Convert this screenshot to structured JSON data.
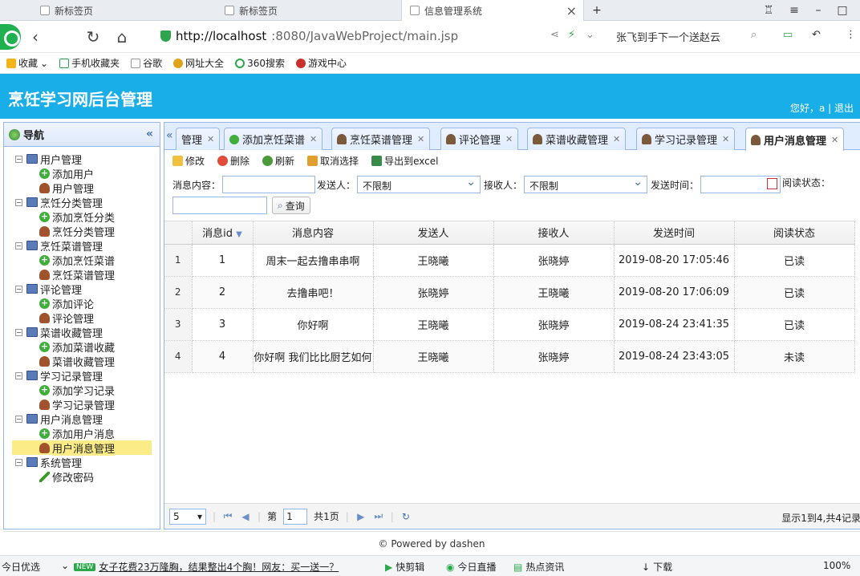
{
  "browser": {
    "tabs": [
      "新标签页",
      "新标签页",
      "信息管理系统"
    ],
    "url_host": "http://localhost",
    "url_rest": ":8080/JavaWebProject/main.jsp",
    "news_ticker": "张飞到手下一个送赵云",
    "bookmarks": [
      "收藏",
      "手机收藏夹",
      "谷歌",
      "网址大全",
      "360搜索",
      "游戏中心"
    ]
  },
  "app": {
    "title": "烹饪学习网后台管理",
    "greeting": "您好，a | 退出"
  },
  "sidebar": {
    "title": "导航",
    "groups": [
      {
        "label": "用户管理",
        "children": [
          "添加用户",
          "用户管理"
        ]
      },
      {
        "label": "烹饪分类管理",
        "children": [
          "添加烹饪分类",
          "烹饪分类管理"
        ]
      },
      {
        "label": "烹饪菜谱管理",
        "children": [
          "添加烹饪菜谱",
          "烹饪菜谱管理"
        ]
      },
      {
        "label": "评论管理",
        "children": [
          "添加评论",
          "评论管理"
        ]
      },
      {
        "label": "菜谱收藏管理",
        "children": [
          "添加菜谱收藏",
          "菜谱收藏管理"
        ]
      },
      {
        "label": "学习记录管理",
        "children": [
          "添加学习记录",
          "学习记录管理"
        ]
      },
      {
        "label": "用户消息管理",
        "children": [
          "添加用户消息",
          "用户消息管理"
        ]
      },
      {
        "label": "系统管理",
        "children": [
          "修改密码"
        ]
      }
    ],
    "selected": "用户消息管理"
  },
  "tabs": [
    "管理",
    "添加烹饪菜谱",
    "烹饪菜谱管理",
    "评论管理",
    "菜谱收藏管理",
    "学习记录管理",
    "用户消息管理"
  ],
  "toolbar": {
    "edit": "修改",
    "delete": "删除",
    "refresh": "刷新",
    "cancel_select": "取消选择",
    "export": "导出到excel"
  },
  "search": {
    "content_label": "消息内容：",
    "sender_label": "发送人：",
    "sender_value": "不限制",
    "receiver_label": "接收人：",
    "receiver_value": "不限制",
    "time_label": "发送时间：",
    "status_label": "阅读状态：",
    "query_button": "查询"
  },
  "grid": {
    "columns": [
      "消息id",
      "消息内容",
      "发送人",
      "接收人",
      "发送时间",
      "阅读状态"
    ],
    "rows": [
      [
        "1",
        "1",
        "周末一起去撸串串啊",
        "王晓曦",
        "张晓婷",
        "2019-08-20 17:05:46",
        "已读"
      ],
      [
        "2",
        "2",
        "去撸串吧！",
        "张晓婷",
        "王晓曦",
        "2019-08-20 17:06:09",
        "已读"
      ],
      [
        "3",
        "3",
        "你好啊",
        "王晓曦",
        "张晓婷",
        "2019-08-24 23:41:35",
        "已读"
      ],
      [
        "4",
        "4",
        "你好啊 我们比比厨艺如何",
        "王晓曦",
        "张晓婷",
        "2019-08-24 23:43:05",
        "未读"
      ]
    ]
  },
  "pager": {
    "page_size": "5",
    "page_prefix": "第",
    "page_value": "1",
    "page_total": "共1页",
    "info": "显示1到4,共4记录"
  },
  "footer": "© Powered by dashen",
  "statusbar": {
    "left": "今日优选",
    "headline": "女子花费23万隆胸，结果整出4个胸！网友：买一送一？",
    "items": [
      "快剪辑",
      "今日直播",
      "热点资讯",
      "下载"
    ],
    "zoom": "100%"
  }
}
